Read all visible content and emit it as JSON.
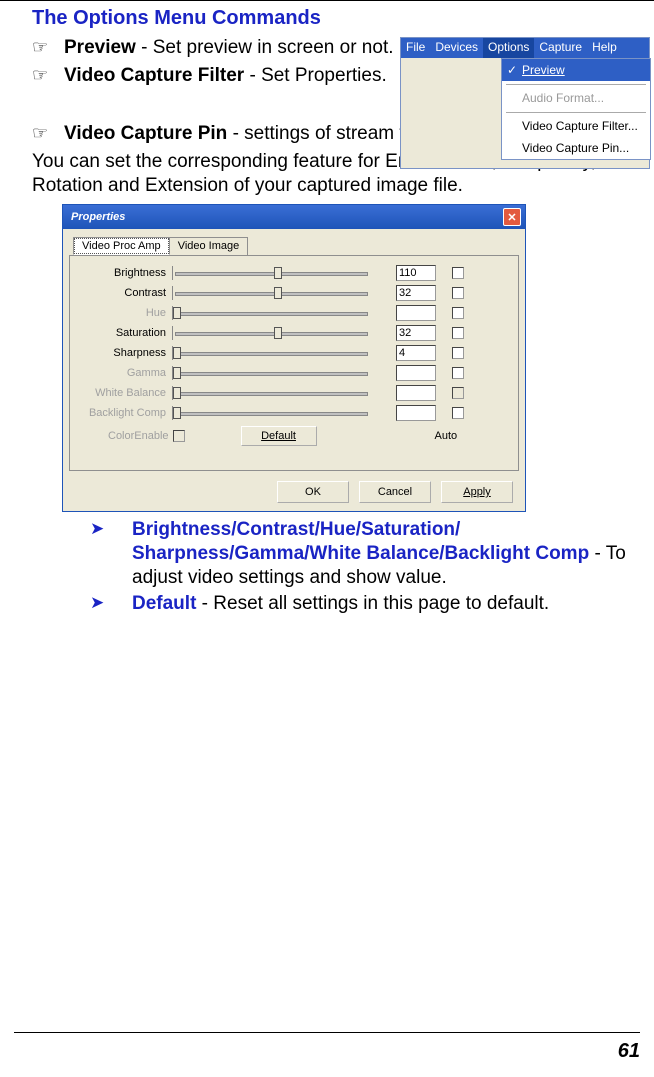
{
  "heading": "The Options Menu Commands",
  "bullets": {
    "b0": {
      "bold": "Preview",
      "rest": " - Set preview in screen or not."
    },
    "b1": {
      "bold": "Video Capture Filter",
      "rest": " - Set Properties."
    },
    "b2": {
      "bold": "Video Capture Pin",
      "rest": " - settings of stream format."
    }
  },
  "paragraph": "You can set the corresponding feature for Environment, Frequency, Rotation and Extension of your captured image file.",
  "menu": {
    "items": [
      "File",
      "Devices",
      "Options",
      "Capture",
      "Help"
    ],
    "dropdown": {
      "d0": "Preview",
      "d1": "Audio Format...",
      "d2": "Video Capture Filter...",
      "d3": "Video Capture Pin..."
    },
    "check": "✓"
  },
  "props": {
    "title": "Properties",
    "close": "✕",
    "tabs": {
      "t0": "Video Proc Amp",
      "t1": "Video Image"
    },
    "rows": {
      "r0": {
        "label": "Brightness",
        "val": "110"
      },
      "r1": {
        "label": "Contrast",
        "val": "32"
      },
      "r2": {
        "label": "Hue",
        "val": ""
      },
      "r3": {
        "label": "Saturation",
        "val": "32"
      },
      "r4": {
        "label": "Sharpness",
        "val": "4"
      },
      "r5": {
        "label": "Gamma",
        "val": ""
      },
      "r6": {
        "label": "White Balance",
        "val": ""
      },
      "r7": {
        "label": "Backlight Comp",
        "val": ""
      }
    },
    "colorEnable": "ColorEnable",
    "defaultBtn": "Default",
    "auto": "Auto",
    "ok": "OK",
    "cancel": "Cancel",
    "apply": "Apply"
  },
  "sub": {
    "s0": {
      "bold": "Brightness/Contrast/Hue/Saturation/ Sharpness/Gamma/White Balance/Backlight Comp",
      "rest": " - To adjust video settings and show value."
    },
    "s1": {
      "bold": "Default",
      "rest": " - Reset all settings in this page to default."
    }
  },
  "glyphs": {
    "hand": "☞",
    "tri": "➤"
  },
  "pageNum": "61"
}
